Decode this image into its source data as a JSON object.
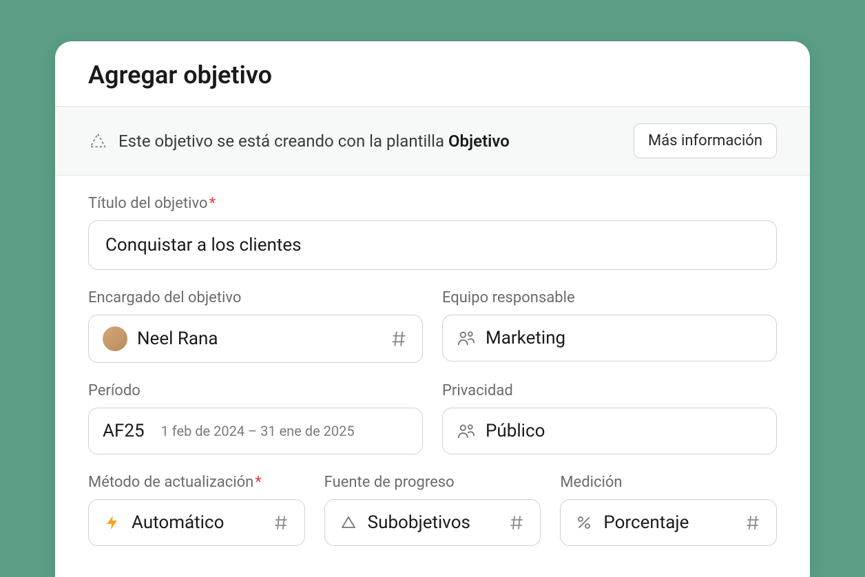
{
  "modal": {
    "title": "Agregar objetivo"
  },
  "banner": {
    "prefix": "Este objetivo se está creando con la plantilla ",
    "template_name": "Objetivo",
    "more_info": "Más información"
  },
  "fields": {
    "title": {
      "label": "Título del objetivo",
      "value": "Conquistar a los clientes"
    },
    "owner": {
      "label": "Encargado del objetivo",
      "value": "Neel Rana"
    },
    "team": {
      "label": "Equipo responsable",
      "value": "Marketing"
    },
    "period": {
      "label": "Período",
      "code": "AF25",
      "range": "1 feb de 2024 – 31 ene de 2025"
    },
    "privacy": {
      "label": "Privacidad",
      "value": "Público"
    },
    "update_method": {
      "label": "Método de actualización",
      "value": "Automático"
    },
    "progress_source": {
      "label": "Fuente de progreso",
      "value": "Subobjetivos"
    },
    "measurement": {
      "label": "Medición",
      "value": "Porcentaje"
    }
  }
}
